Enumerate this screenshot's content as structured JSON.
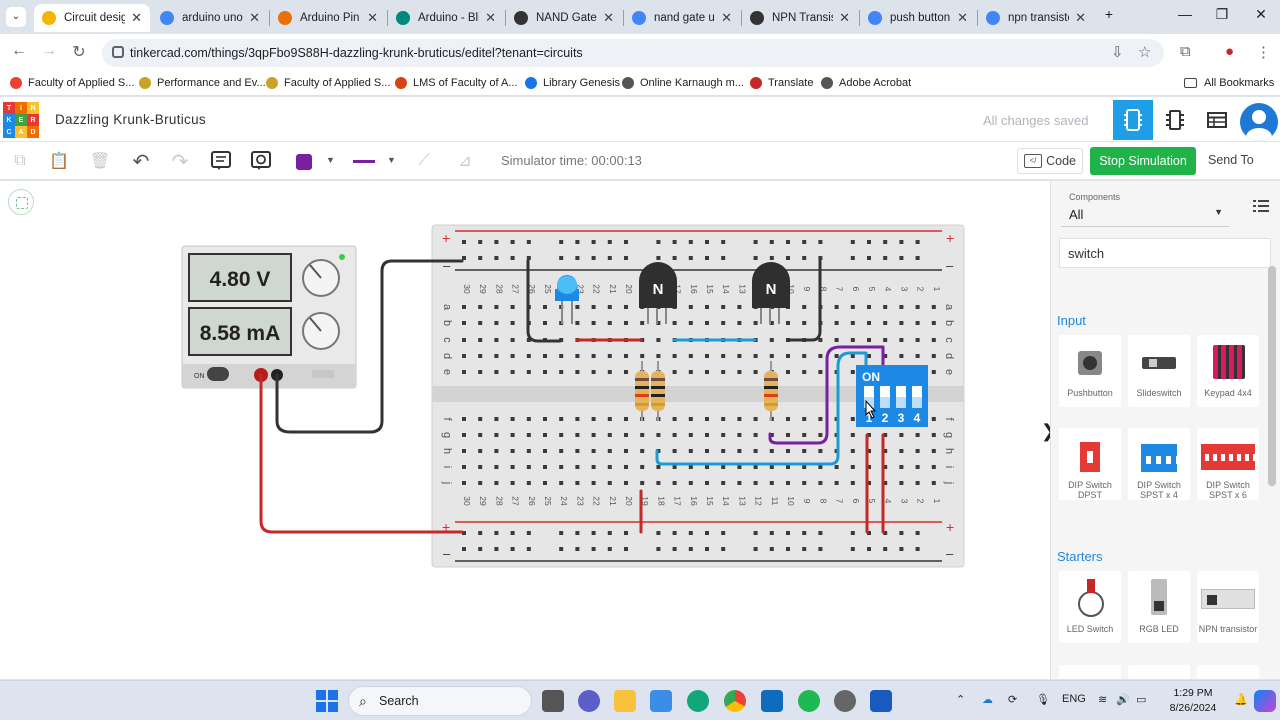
{
  "browser": {
    "tabs": [
      {
        "title": "Circuit design",
        "active": true
      },
      {
        "title": "arduino uno ("
      },
      {
        "title": "Arduino Pin C"
      },
      {
        "title": "Arduino - Bli"
      },
      {
        "title": "NAND Gate u"
      },
      {
        "title": "nand gate us"
      },
      {
        "title": "NPN Transist"
      },
      {
        "title": "push button"
      },
      {
        "title": "npn transisto"
      }
    ],
    "url": "tinkercad.com/things/3qpFbo9S88H-dazzling-krunk-bruticus/editel?tenant=circuits",
    "bookmarks": [
      "Faculty of Applied S...",
      "Performance and Ev...",
      "Faculty of Applied S...",
      "LMS of Faculty of A...",
      "Library Genesis",
      "Online Karnaugh m...",
      "Translate",
      "Adobe Acrobat"
    ],
    "all_bookmarks": "All Bookmarks"
  },
  "app": {
    "logo_letters": [
      "T",
      "I",
      "N",
      "K",
      "E",
      "R",
      "C",
      "A",
      "D"
    ],
    "design_name": "Dazzling Krunk-Bruticus",
    "save_status": "All changes saved"
  },
  "toolbar": {
    "simulator_time": "Simulator time: 00:00:13",
    "code_label": "Code",
    "stop_label": "Stop Simulation",
    "send_label": "Send To",
    "fill_color": "#7b1fa2",
    "wire_color": "#7b1fa2"
  },
  "circuit": {
    "voltage": "4.80 V",
    "current": "8.58 mA",
    "power_label": "ON",
    "transistor_label": "N",
    "dip_label": "ON",
    "dip_numbers": [
      "1",
      "2",
      "3",
      "4"
    ],
    "breadboard_columns": [
      "30",
      "29",
      "28",
      "27",
      "26",
      "25",
      "24",
      "23",
      "22",
      "21",
      "20",
      "19",
      "18",
      "17",
      "16",
      "15",
      "14",
      "13",
      "12",
      "11",
      "10",
      "9",
      "8",
      "7",
      "6",
      "5",
      "4",
      "3",
      "2",
      "1"
    ],
    "row_letters_top": [
      "a",
      "b",
      "c",
      "d",
      "e"
    ],
    "row_letters_bottom": [
      "f",
      "g",
      "h",
      "i",
      "j"
    ]
  },
  "panel": {
    "components_label": "Components",
    "components_value": "All",
    "search_value": "switch",
    "input_title": "Input",
    "starters_title": "Starters",
    "input_items": [
      "Pushbutton",
      "Slideswitch",
      "Keypad 4x4",
      "DIP Switch DPST",
      "DIP Switch SPST x 4",
      "DIP Switch SPST x 6"
    ],
    "starter_items": [
      "LED Switch",
      "RGB LED",
      "NPN transistor"
    ]
  },
  "taskbar": {
    "search_label": "Search",
    "language": "ENG",
    "time": "1:29 PM",
    "date": "8/26/2024"
  }
}
